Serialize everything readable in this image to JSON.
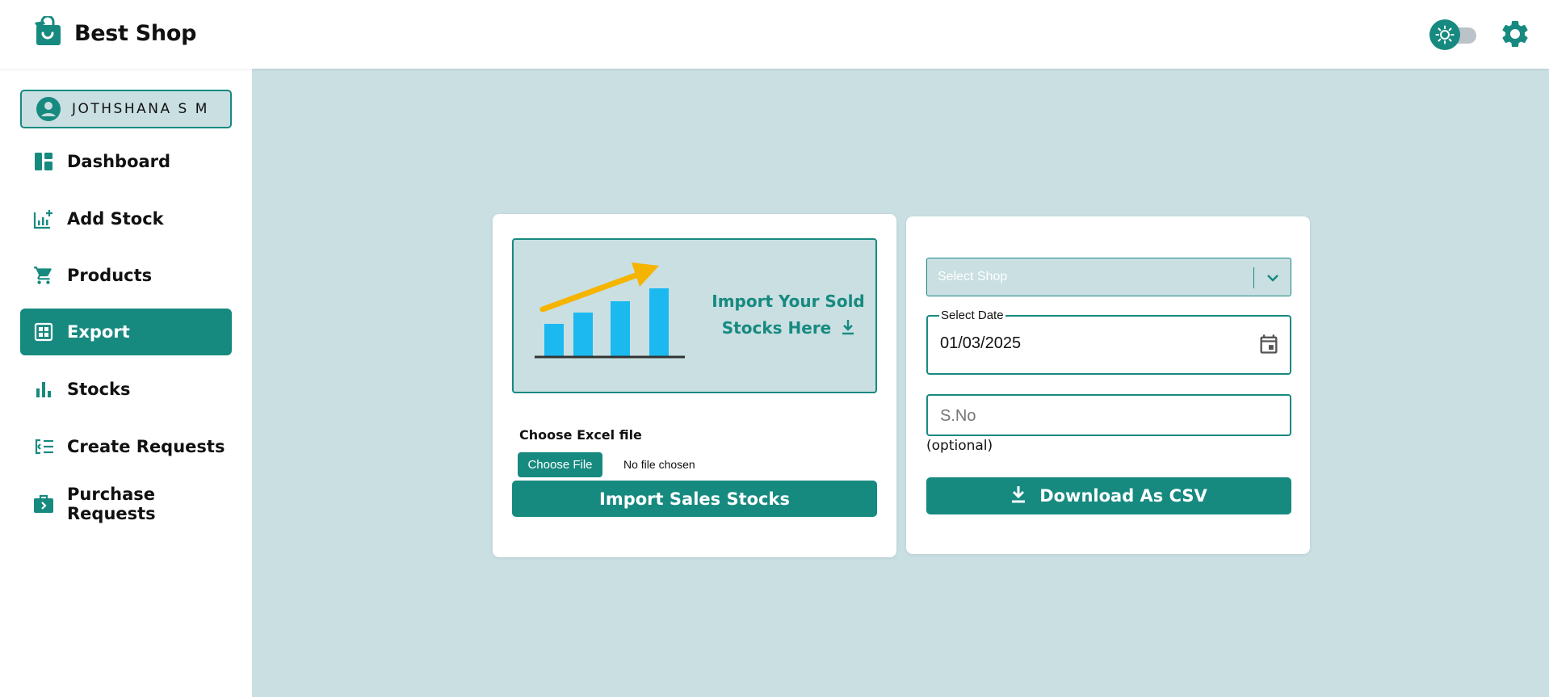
{
  "app": {
    "brand_name": "Best Shop",
    "brand_icon": "shopping-bag-icon",
    "accent_color": "#178a80",
    "background_color": "#c9dfe2"
  },
  "header": {
    "theme_toggle_icon": "sun-icon",
    "settings_icon": "gear-icon"
  },
  "sidebar": {
    "user": {
      "name": "JOTHSHANA S M",
      "icon": "account-circle-icon"
    },
    "items": [
      {
        "label": "Dashboard",
        "icon": "dashboard-icon",
        "active": false
      },
      {
        "label": "Add Stock",
        "icon": "add-chart-icon",
        "active": false
      },
      {
        "label": "Products",
        "icon": "cart-icon",
        "active": false
      },
      {
        "label": "Export",
        "icon": "grid-icon",
        "active": true
      },
      {
        "label": "Stocks",
        "icon": "bar-chart-icon",
        "active": false
      },
      {
        "label": "Create Requests",
        "icon": "checklist-icon",
        "active": false
      },
      {
        "label": "Purchase Requests",
        "icon": "briefcase-icon",
        "active": false
      }
    ]
  },
  "import_card": {
    "banner_text": "Import Your Sold Stocks Here",
    "file_label": "Choose Excel file",
    "choose_file_label": "Choose File",
    "no_file_text": "No file chosen",
    "import_button_label": "Import Sales Stocks"
  },
  "export_card": {
    "select_shop_placeholder": "Select Shop",
    "date_label": "Select Date",
    "date_value": "01/03/2025",
    "sno_placeholder": "S.No",
    "sno_hint": "(optional)",
    "download_button_label": "Download As CSV"
  }
}
